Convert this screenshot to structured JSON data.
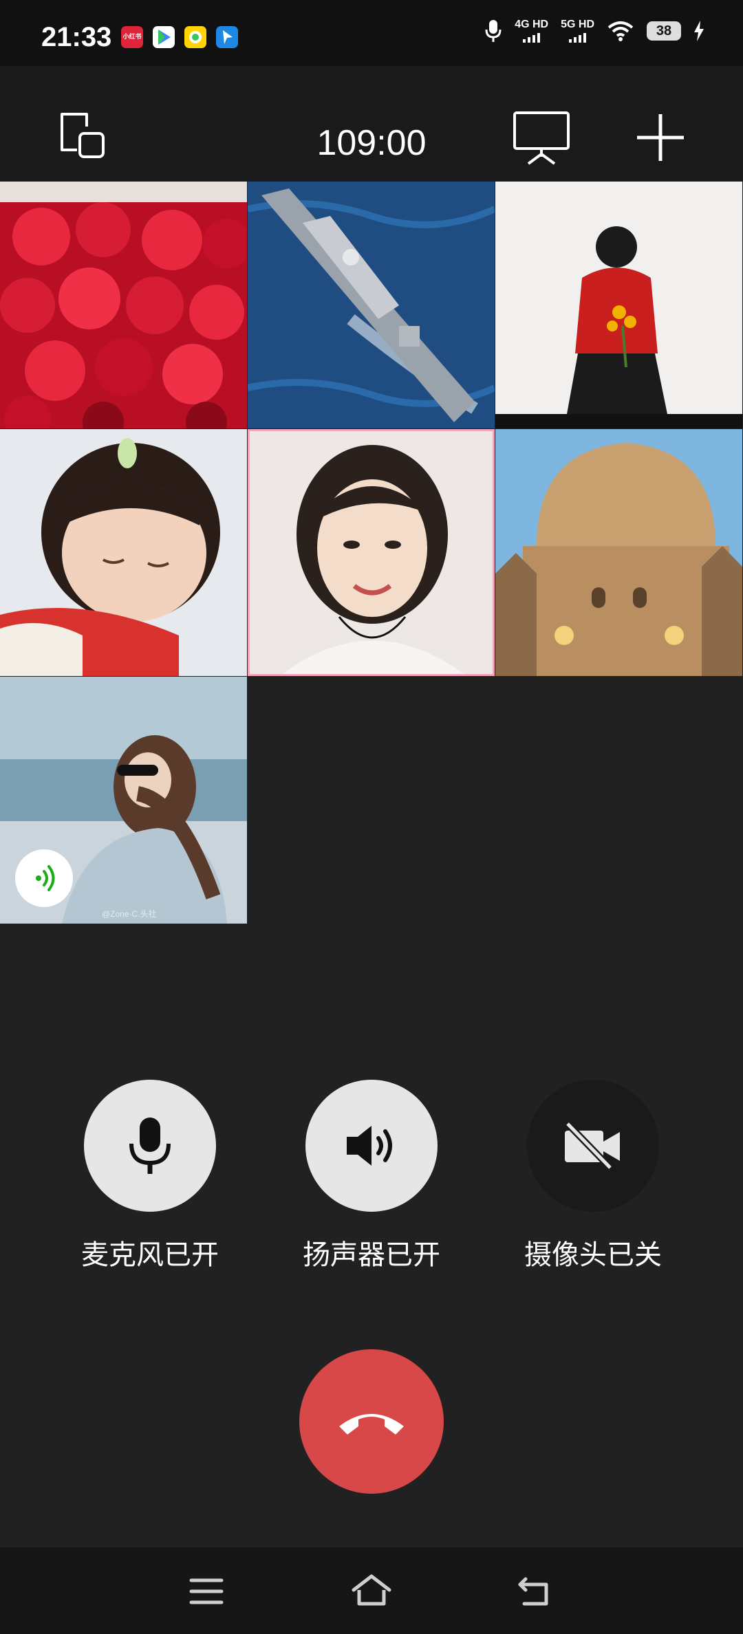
{
  "status_bar": {
    "time": "21:33",
    "app_icons": [
      {
        "name": "xiaohongshu-icon",
        "color": "#e0243a",
        "label": "小红书"
      },
      {
        "name": "media-app-icon",
        "color": "#3a86ff"
      },
      {
        "name": "yellow-app-icon",
        "color": "#ffd400"
      },
      {
        "name": "navigation-app-icon",
        "color": "#1e88e5"
      }
    ],
    "network_1": "4G HD",
    "network_2": "5G HD",
    "battery": "38"
  },
  "toolbar": {
    "call_timer": "109:00",
    "icons": [
      "switch-window-icon",
      "screen-share-icon",
      "add-participant-icon"
    ]
  },
  "participants": [
    {
      "name": "participant-roses",
      "palette": [
        "#c5102a",
        "#e8283e",
        "#8a0a1a"
      ]
    },
    {
      "name": "participant-warship",
      "palette": [
        "#1f4d82",
        "#2b6aa8",
        "#c8ccd2"
      ]
    },
    {
      "name": "participant-woman-sunflowers",
      "palette": [
        "#f1f0ee",
        "#c9201f",
        "#1b1b1b"
      ]
    },
    {
      "name": "participant-baby",
      "palette": [
        "#e6e9ee",
        "#f2d2bd",
        "#d8322e"
      ]
    },
    {
      "name": "participant-smiling-woman",
      "palette": [
        "#ede7e6",
        "#f4dccb",
        "#2a211c"
      ],
      "speaking": true
    },
    {
      "name": "participant-cathedral",
      "palette": [
        "#7fb6df",
        "#c9a06f",
        "#8a6a48"
      ]
    },
    {
      "name": "participant-beach-woman",
      "palette": [
        "#b3c9d6",
        "#7a9fb3",
        "#c9d4dc"
      ],
      "audio_active": true,
      "watermark": "@Zone·C.头社"
    }
  ],
  "controls": {
    "mic_label": "麦克风已开",
    "speaker_label": "扬声器已开",
    "camera_label": "摄像头已关",
    "mic_on": true,
    "speaker_on": true,
    "camera_on": false
  },
  "colors": {
    "hangup": "#d94848",
    "control_on": "#e6e6e6",
    "control_off": "#1a1a1a",
    "audio_badge": "#1aad19"
  },
  "nav_icons": [
    "menu-icon",
    "home-icon",
    "back-icon"
  ]
}
